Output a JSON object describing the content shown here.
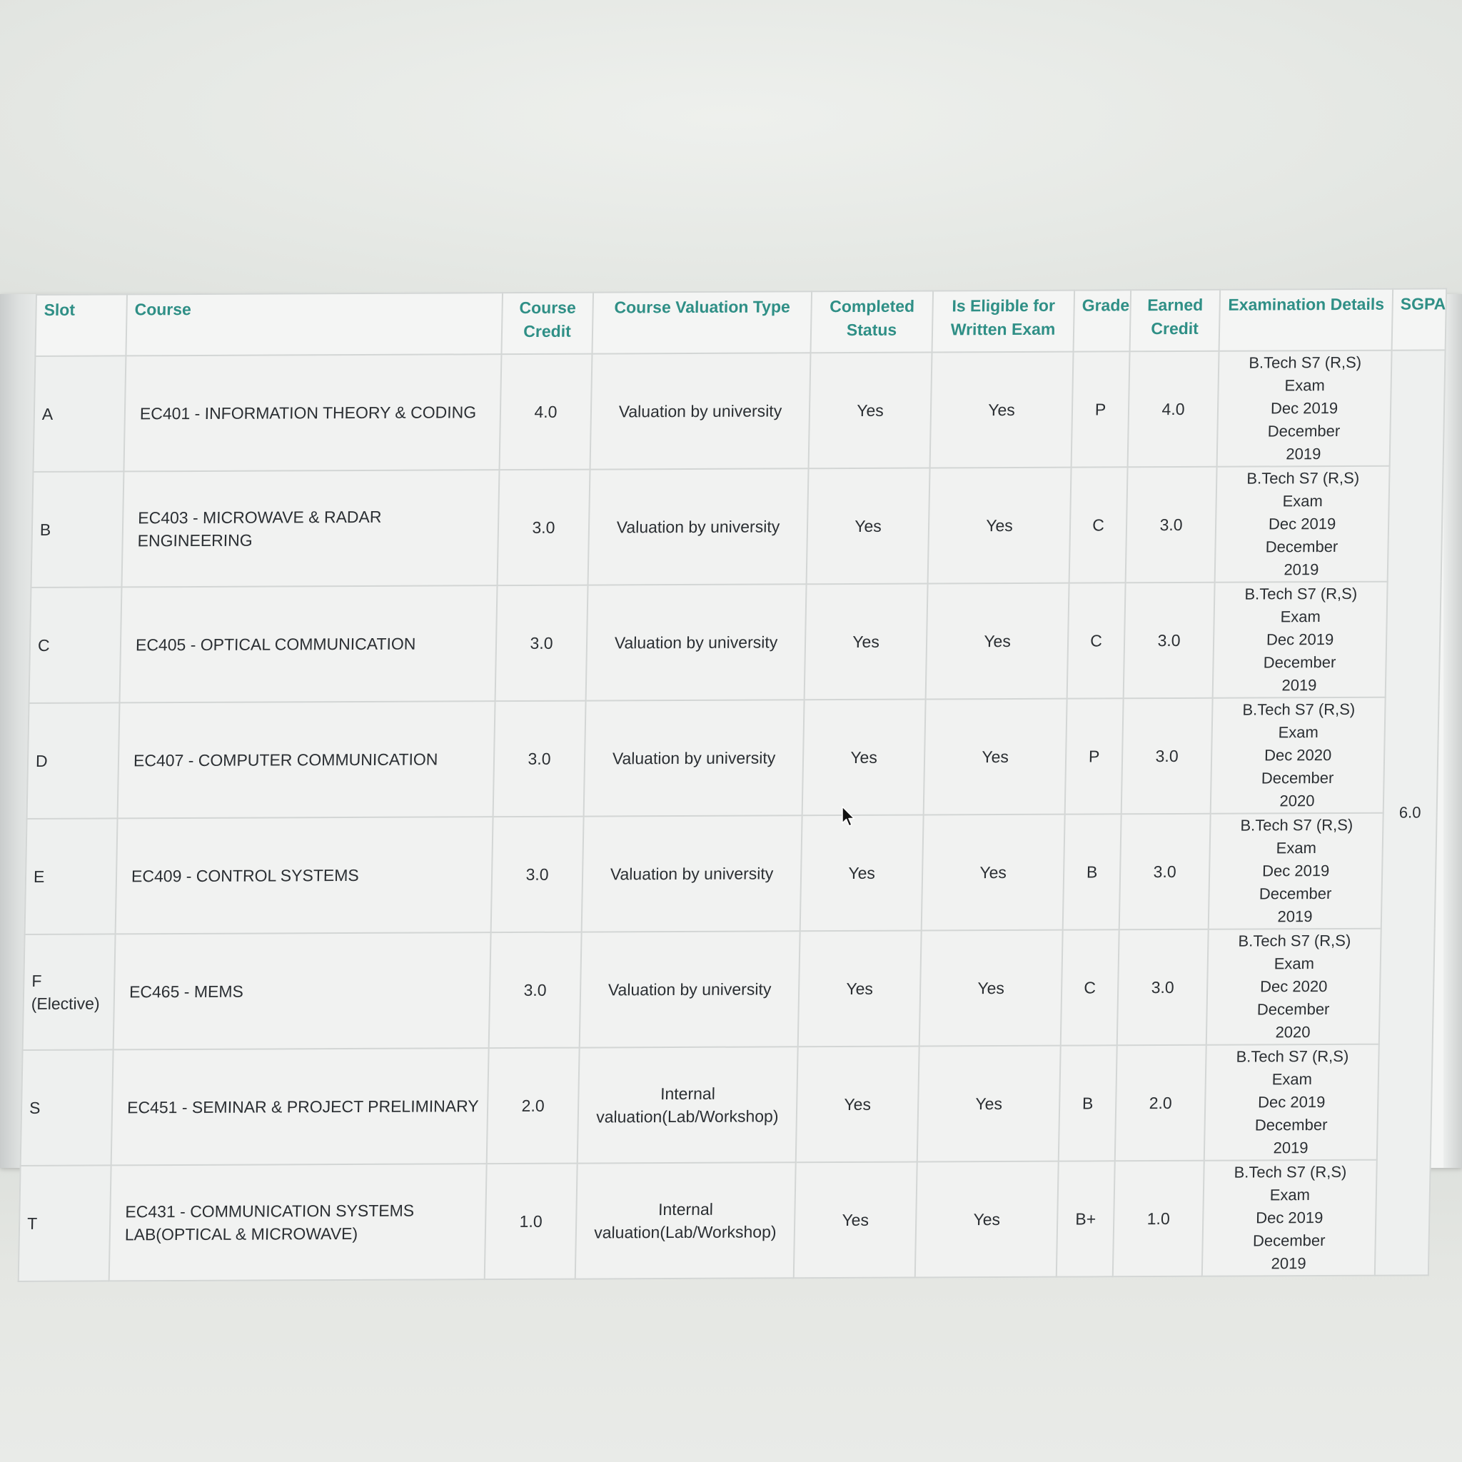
{
  "table": {
    "headers": {
      "slot": "Slot",
      "course": "Course",
      "course_credit_line1": "Course",
      "course_credit_line2": "Credit",
      "valuation_type": "Course Valuation Type",
      "completed_line1": "Completed",
      "completed_line2": "Status",
      "eligible_line1": "Is Eligible for",
      "eligible_line2": "Written Exam",
      "grade": "Grade",
      "earned_line1": "Earned",
      "earned_line2": "Credit",
      "exam_details": "Examination Details",
      "sgpa": "SGPA"
    },
    "sgpa": "6.0",
    "rows": [
      {
        "slot": "A",
        "slot_sub": "",
        "course_line1": "EC401 - INFORMATION THEORY & CODING",
        "course_line2": "",
        "credit": "4.0",
        "valuation_line1": "Valuation by university",
        "valuation_line2": "",
        "completed": "Yes",
        "eligible": "Yes",
        "grade": "P",
        "earned": "4.0",
        "exam_line1": "B.Tech S7 (R,S) Exam",
        "exam_line2": "Dec 2019",
        "exam_line3": "December",
        "exam_line4": "2019"
      },
      {
        "slot": "B",
        "slot_sub": "",
        "course_line1": "EC403 - MICROWAVE & RADAR ENGINEERING",
        "course_line2": "",
        "credit": "3.0",
        "valuation_line1": "Valuation by university",
        "valuation_line2": "",
        "completed": "Yes",
        "eligible": "Yes",
        "grade": "C",
        "earned": "3.0",
        "exam_line1": "B.Tech S7 (R,S) Exam",
        "exam_line2": "Dec 2019",
        "exam_line3": "December",
        "exam_line4": "2019"
      },
      {
        "slot": "C",
        "slot_sub": "",
        "course_line1": "EC405 - OPTICAL COMMUNICATION",
        "course_line2": "",
        "credit": "3.0",
        "valuation_line1": "Valuation by university",
        "valuation_line2": "",
        "completed": "Yes",
        "eligible": "Yes",
        "grade": "C",
        "earned": "3.0",
        "exam_line1": "B.Tech S7 (R,S) Exam",
        "exam_line2": "Dec 2019",
        "exam_line3": "December",
        "exam_line4": "2019"
      },
      {
        "slot": "D",
        "slot_sub": "",
        "course_line1": "EC407 - COMPUTER COMMUNICATION",
        "course_line2": "",
        "credit": "3.0",
        "valuation_line1": "Valuation by university",
        "valuation_line2": "",
        "completed": "Yes",
        "eligible": "Yes",
        "grade": "P",
        "earned": "3.0",
        "exam_line1": "B.Tech S7 (R,S) Exam",
        "exam_line2": "Dec 2020",
        "exam_line3": "December",
        "exam_line4": "2020"
      },
      {
        "slot": "E",
        "slot_sub": "",
        "course_line1": "EC409 - CONTROL SYSTEMS",
        "course_line2": "",
        "credit": "3.0",
        "valuation_line1": "Valuation by university",
        "valuation_line2": "",
        "completed": "Yes",
        "eligible": "Yes",
        "grade": "B",
        "earned": "3.0",
        "exam_line1": "B.Tech S7 (R,S) Exam",
        "exam_line2": "Dec 2019",
        "exam_line3": "December",
        "exam_line4": "2019"
      },
      {
        "slot": "F",
        "slot_sub": "(Elective)",
        "course_line1": "EC465 - MEMS",
        "course_line2": "",
        "credit": "3.0",
        "valuation_line1": "Valuation by university",
        "valuation_line2": "",
        "completed": "Yes",
        "eligible": "Yes",
        "grade": "C",
        "earned": "3.0",
        "exam_line1": "B.Tech S7 (R,S) Exam",
        "exam_line2": "Dec 2020",
        "exam_line3": "December",
        "exam_line4": "2020"
      },
      {
        "slot": "S",
        "slot_sub": "",
        "course_line1": "EC451 - SEMINAR & PROJECT PRELIMINARY",
        "course_line2": "",
        "credit": "2.0",
        "valuation_line1": "Internal",
        "valuation_line2": "valuation(Lab/Workshop)",
        "completed": "Yes",
        "eligible": "Yes",
        "grade": "B",
        "earned": "2.0",
        "exam_line1": "B.Tech S7 (R,S) Exam",
        "exam_line2": "Dec 2019",
        "exam_line3": "December",
        "exam_line4": "2019"
      },
      {
        "slot": "T",
        "slot_sub": "",
        "course_line1": "EC431 - COMMUNICATION SYSTEMS",
        "course_line2": "LAB(OPTICAL & MICROWAVE)",
        "credit": "1.0",
        "valuation_line1": "Internal",
        "valuation_line2": "valuation(Lab/Workshop)",
        "completed": "Yes",
        "eligible": "Yes",
        "grade": "B+",
        "earned": "1.0",
        "exam_line1": "B.Tech S7 (R,S) Exam",
        "exam_line2": "Dec 2019",
        "exam_line3": "December",
        "exam_line4": "2019"
      }
    ]
  },
  "colors": {
    "header_text": "#2f8f86",
    "body_text": "#2b2f33",
    "grid_line": "#d3d6d5"
  },
  "icons": {
    "cursor": "mouse-pointer-icon"
  }
}
